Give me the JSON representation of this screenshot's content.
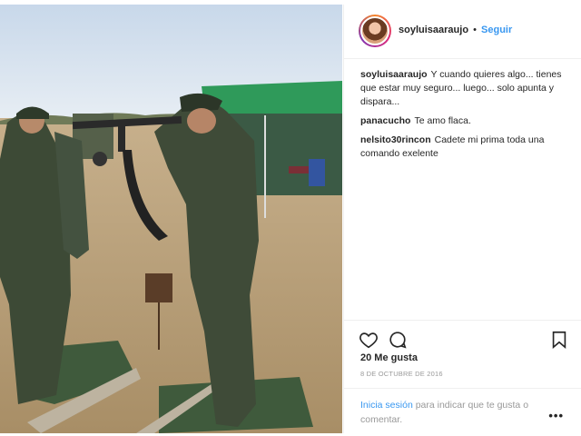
{
  "post": {
    "username": "soyluisaaraujo",
    "separator": "•",
    "follow_label": "Seguir",
    "photo_icon": "military-training-photo"
  },
  "comments": [
    {
      "user": "soyluisaaraujo",
      "text": "Y cuando quieres algo... tienes que estar muy seguro... luego... solo apunta y dispara..."
    },
    {
      "user": "panacucho",
      "text": "Te amo flaca."
    },
    {
      "user": "nelsito30rincon",
      "text": "Cadete mi prima toda una comando exelente"
    }
  ],
  "actions": {
    "like_icon": "heart-icon",
    "comment_icon": "comment-icon",
    "save_icon": "bookmark-icon"
  },
  "likes": "20 Me gusta",
  "date": "8 DE OCTUBRE DE 2016",
  "footer": {
    "login_link": "Inicia sesión",
    "login_text": " para indicar que te gusta o comentar.",
    "more": "•••"
  },
  "colors": {
    "link": "#3897f0",
    "muted": "#999999",
    "border": "#efefef"
  }
}
